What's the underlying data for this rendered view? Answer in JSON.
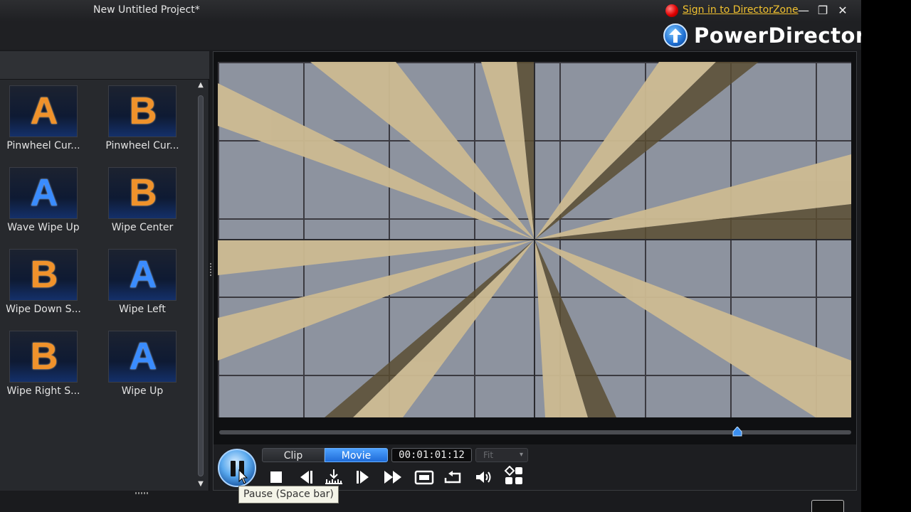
{
  "window": {
    "title": "New Untitled Project*",
    "signin_link": "Sign in to DirectorZone",
    "minimize_glyph": "—",
    "restore_glyph": "❐",
    "close_glyph": "✕"
  },
  "brand": {
    "name": "PowerDirector",
    "logo_icon": "upload-arrow-icon"
  },
  "library": {
    "transitions": [
      {
        "label": "Pinwheel Cur...",
        "glyph": "A",
        "color": "orange"
      },
      {
        "label": "Pinwheel Cur...",
        "glyph": "B",
        "color": "orange"
      },
      {
        "label": "Wave Wipe Up",
        "glyph": "A",
        "color": "blue"
      },
      {
        "label": "Wipe Center",
        "glyph": "B",
        "color": "orange"
      },
      {
        "label": "Wipe Down S...",
        "glyph": "B",
        "color": "orange"
      },
      {
        "label": "Wipe Left",
        "glyph": "A",
        "color": "blue"
      },
      {
        "label": "Wipe Right S...",
        "glyph": "B",
        "color": "orange"
      },
      {
        "label": "Wipe Up",
        "glyph": "A",
        "color": "blue"
      }
    ],
    "scroll_up_glyph": "▲",
    "scroll_down_glyph": "▼"
  },
  "preview": {
    "timeline_progress": 0.82,
    "mode_clip": "Clip",
    "mode_movie": "Movie",
    "active_mode": "Movie",
    "timecode": "00:01:01:12",
    "zoom_select": "Fit",
    "zoom_caret": "▾",
    "tooltip": "Pause (Space bar)",
    "controls": [
      "pause-icon",
      "stop-icon",
      "previous-frame-icon",
      "split-icon",
      "next-frame-icon",
      "fast-forward-icon",
      "snapshot-icon",
      "repeat-icon",
      "volume-icon",
      "layout-icon"
    ]
  },
  "colors": {
    "accent_blue": "#1f6cd8",
    "link_yellow": "#f2c230",
    "record_red": "#e00000",
    "transition_orange": "#f0922b",
    "transition_blue": "#3a8cff"
  }
}
